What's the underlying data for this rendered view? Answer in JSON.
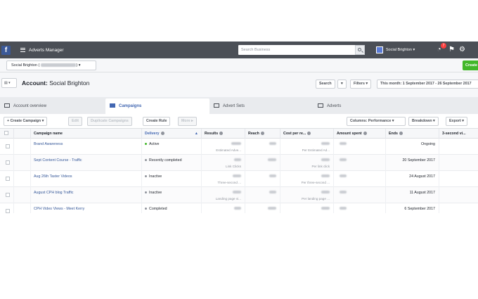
{
  "topbar": {
    "logo": "f",
    "app_name": "Adverts Manager",
    "search_placeholder": "Search Business",
    "account_name": "Social Brighton",
    "notification_count": "7"
  },
  "account_bar": {
    "account_select": "Social Brighton (",
    "create_label": "Create"
  },
  "header": {
    "title_prefix": "Account:",
    "title_name": "Social Brighton",
    "search_label": "Search",
    "filters_label": "Filters",
    "date_range": "This month: 1 September 2017 - 26 September 2017"
  },
  "tabs": [
    {
      "label": "Account overview",
      "active": false
    },
    {
      "label": "Campaigns",
      "active": true
    },
    {
      "label": "Advert Sets",
      "active": false
    },
    {
      "label": "Adverts",
      "active": false
    }
  ],
  "toolbar": {
    "create_campaign": "Create Campaign",
    "edit": "Edit",
    "duplicate": "Duplicate Campaigns",
    "create_rule": "Create Rule",
    "more": "More",
    "columns": "Columns: Performance",
    "breakdown": "Breakdown",
    "export": "Export"
  },
  "table": {
    "columns": [
      "Campaign name",
      "Delivery",
      "Results",
      "Reach",
      "Cost per re...",
      "Amount spent",
      "Ends",
      "3-second vi..."
    ],
    "rows": [
      {
        "name": "Brand Awareness",
        "on": true,
        "delivery": "Active",
        "delivery_color": "#42b72a",
        "result_sub": "Estimated Adve...",
        "cost_sub": "Per Estimated Ad...",
        "ends": "Ongoing"
      },
      {
        "name": "Sept Content Course - Traffic",
        "on": true,
        "delivery": "Recently completed",
        "delivery_color": "#90949c",
        "result_sub": "Link Clicks",
        "cost_sub": "Per link click",
        "ends": "20 September 2017"
      },
      {
        "name": "Aug 26th Taster Videos",
        "on": false,
        "delivery": "Inactive",
        "delivery_color": "#90949c",
        "result_sub": "Three-second ...",
        "cost_sub": "Per three-second ...",
        "ends": "24 August 2017"
      },
      {
        "name": "August CPH blog Traffic",
        "on": false,
        "delivery": "Inactive",
        "delivery_color": "#90949c",
        "result_sub": "Landing page vi...",
        "cost_sub": "Per landing page ...",
        "ends": "11 August 2017"
      },
      {
        "name": "CPH Video Views - Meet Kerry",
        "on": true,
        "delivery": "Completed",
        "delivery_color": "#90949c",
        "result_sub": "",
        "cost_sub": "",
        "ends": "6 September 2017"
      }
    ]
  }
}
